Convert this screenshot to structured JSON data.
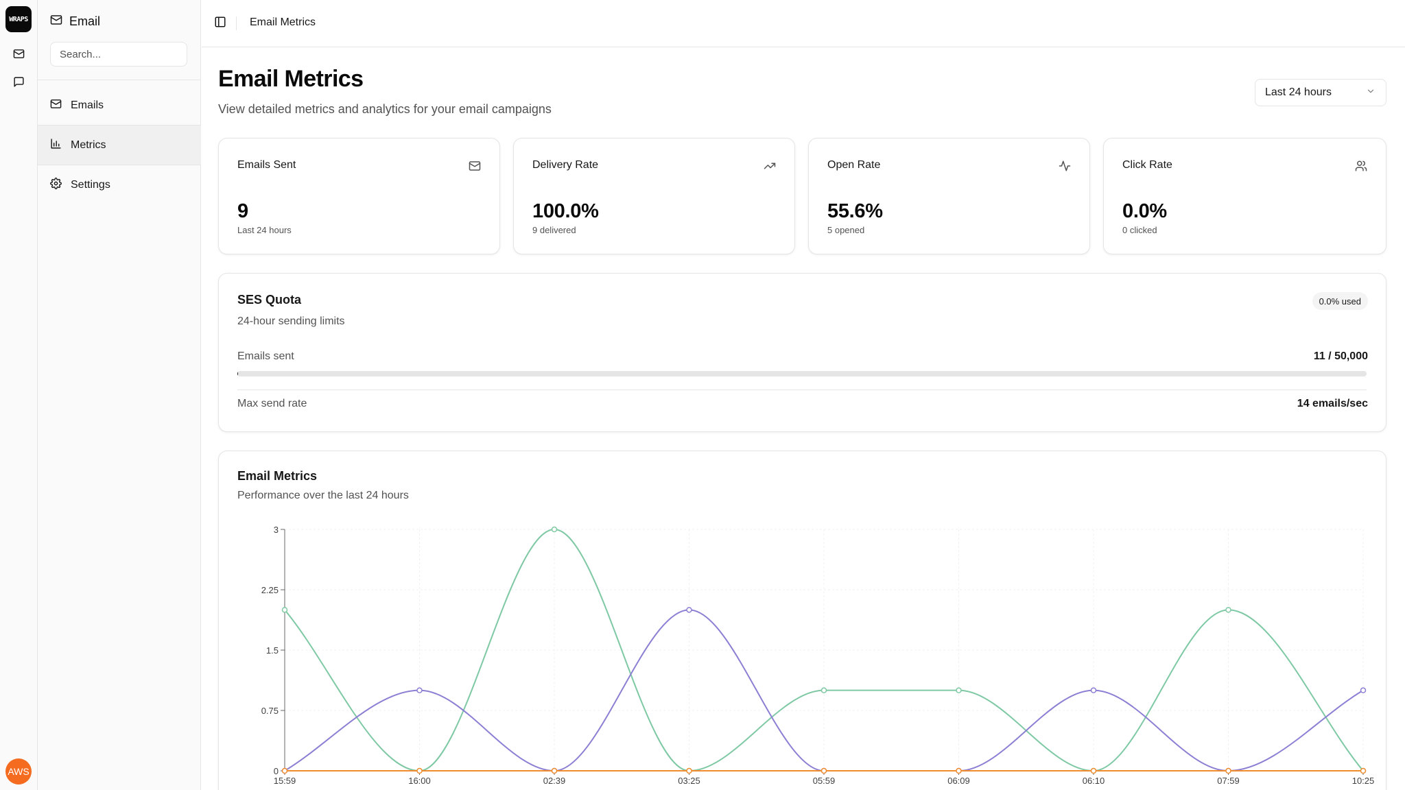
{
  "brand": {
    "logo_text": "WRAPS",
    "cloud_badge": "AWS"
  },
  "rail": {
    "items": [
      "mail-icon",
      "message-square-icon"
    ]
  },
  "sidebar": {
    "title": "Email",
    "search_placeholder": "Search...",
    "items": [
      {
        "label": "Emails",
        "icon": "mail-icon",
        "active": false
      },
      {
        "label": "Metrics",
        "icon": "bar-chart-icon",
        "active": true
      },
      {
        "label": "Settings",
        "icon": "gear-icon",
        "active": false
      }
    ]
  },
  "header": {
    "breadcrumb": "Email Metrics"
  },
  "page": {
    "title": "Email Metrics",
    "subtitle": "View detailed metrics and analytics for your email campaigns",
    "range_select": "Last 24 hours"
  },
  "stats": [
    {
      "title": "Emails Sent",
      "value": "9",
      "foot": "Last 24 hours",
      "icon": "mail-icon"
    },
    {
      "title": "Delivery Rate",
      "value": "100.0%",
      "foot": "9 delivered",
      "icon": "trending-up-icon"
    },
    {
      "title": "Open Rate",
      "value": "55.6%",
      "foot": "5 opened",
      "icon": "activity-icon"
    },
    {
      "title": "Click Rate",
      "value": "0.0%",
      "foot": "0 clicked",
      "icon": "users-icon"
    }
  ],
  "quota": {
    "title": "SES Quota",
    "subtitle": "24-hour sending limits",
    "badge": "0.0% used",
    "sent_label": "Emails sent",
    "sent_value": "11 / 50,000",
    "used_fraction": 0.00022,
    "rate_label": "Max send rate",
    "rate_value": "14 emails/sec"
  },
  "metrics_card": {
    "title": "Email Metrics",
    "subtitle": "Performance over the last 24 hours"
  },
  "chart_data": {
    "type": "line",
    "x": [
      "15:59",
      "16:00",
      "02:39",
      "03:25",
      "05:59",
      "06:09",
      "06:10",
      "07:59",
      "10:25"
    ],
    "y_ticks": [
      0,
      0.75,
      1.5,
      2.25,
      3
    ],
    "ylim": [
      0,
      3
    ],
    "grid": true,
    "series": [
      {
        "color": "#7ec9a4",
        "values": [
          2,
          0,
          3,
          0,
          1,
          1,
          0,
          2,
          0
        ]
      },
      {
        "color": "#8b7fd4",
        "values": [
          0,
          1,
          0,
          2,
          0,
          0,
          1,
          0,
          1
        ]
      },
      {
        "color": "#f08c2d",
        "values": [
          0,
          0,
          0,
          0,
          0,
          0,
          0,
          0,
          0
        ]
      }
    ]
  }
}
